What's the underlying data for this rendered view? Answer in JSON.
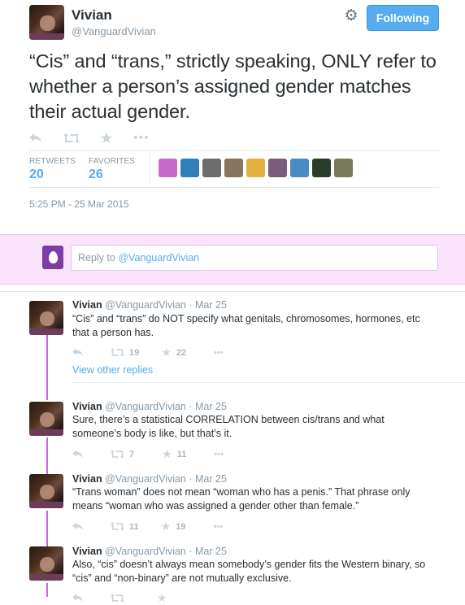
{
  "tweet": {
    "author_name": "Vivian",
    "author_handle": "@VanguardVivian",
    "follow_label": "Following",
    "text": "“Cis” and “trans,” strictly speaking, ONLY refer to whether a person’s assigned gender matches their actual gender.",
    "actions": [
      "reply-icon",
      "retweet-icon",
      "favorite-icon",
      "more-icon"
    ],
    "retweets_label": "RETWEETS",
    "retweets_count": "20",
    "favorites_label": "FAVORITES",
    "favorites_count": "26",
    "timestamp": "5:25 PM - 25 Mar 2015"
  },
  "favoriters_colors": [
    "#c76bc9",
    "#2f7fb8",
    "#6d6d6d",
    "#8a7460",
    "#e3b042",
    "#7a5c7c",
    "#4a8bc4",
    "#2b3c2b",
    "#7a7a5c"
  ],
  "reply_box": {
    "prefix": "Reply to ",
    "mention": "@VanguardVivian"
  },
  "replies": [
    {
      "name": "Vivian",
      "meta": "@VanguardVivian · Mar 25",
      "text": "“Cis” and “trans” do NOT specify what genitals, chromosomes, hormones, etc that a person has.",
      "retweets": "19",
      "favorites": "22"
    },
    {
      "name": "Vivian",
      "meta": "@VanguardVivian · Mar 25",
      "text": "Sure, there’s a statistical CORRELATION between cis/trans and what someone’s body is like, but that’s it.",
      "retweets": "7",
      "favorites": "11"
    },
    {
      "name": "Vivian",
      "meta": "@VanguardVivian · Mar 25",
      "text": "“Trans woman” does not mean “woman who has a penis.” That phrase only means “woman who was assigned a gender other than female.”",
      "retweets": "11",
      "favorites": "19"
    },
    {
      "name": "Vivian",
      "meta": "@VanguardVivian · Mar 25",
      "text": "Also, “cis” doesn’t always mean somebody’s gender fits the Western binary, so “cis” and “non-binary” are not mutually exclusive.",
      "retweets": "",
      "favorites": ""
    }
  ],
  "view_other_replies": "View other replies",
  "colors": {
    "accent": "#55acee",
    "thread_line": "#cc66e0",
    "reply_band": "#fbe4fb"
  }
}
